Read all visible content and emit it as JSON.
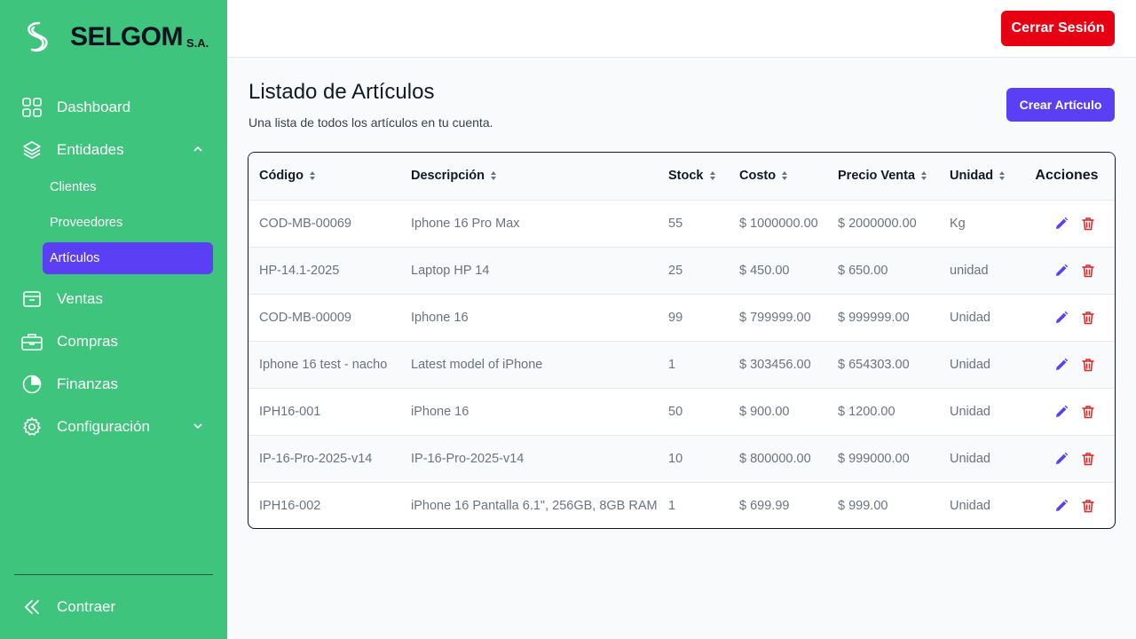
{
  "brand": {
    "name": "SELGOM",
    "suffix": "S.A."
  },
  "sidebar": {
    "items": [
      {
        "label": "Dashboard",
        "icon": "grid-icon"
      },
      {
        "label": "Entidades",
        "icon": "layers-icon",
        "expanded": true,
        "children": [
          {
            "label": "Clientes"
          },
          {
            "label": "Proveedores"
          },
          {
            "label": "Artículos",
            "active": true
          }
        ]
      },
      {
        "label": "Ventas",
        "icon": "archive-box-icon"
      },
      {
        "label": "Compras",
        "icon": "briefcase-icon"
      },
      {
        "label": "Finanzas",
        "icon": "pie-chart-icon"
      },
      {
        "label": "Configuración",
        "icon": "gear-icon",
        "expanded": false
      }
    ],
    "collapse_label": "Contraer"
  },
  "header": {
    "logout_label": "Cerrar Sesión"
  },
  "page": {
    "title": "Listado de Artículos",
    "subtitle": "Una lista de todos los artículos en tu cuenta.",
    "create_label": "Crear Artículo"
  },
  "table": {
    "columns": [
      "Código",
      "Descripción",
      "Stock",
      "Costo",
      "Precio Venta",
      "Unidad",
      "Acciones"
    ],
    "rows": [
      [
        "COD-MB-00069",
        "Iphone 16 Pro Max",
        "55",
        "$ 1000000.00",
        "$ 2000000.00",
        "Kg"
      ],
      [
        "HP-14.1-2025",
        "Laptop HP 14",
        "25",
        "$ 450.00",
        "$ 650.00",
        "unidad"
      ],
      [
        "COD-MB-00009",
        "Iphone 16",
        "99",
        "$ 799999.00",
        "$ 999999.00",
        "Unidad"
      ],
      [
        "Iphone 16 test - nacho",
        "Latest model of iPhone",
        "1",
        "$ 303456.00",
        "$ 654303.00",
        "Unidad"
      ],
      [
        "IPH16-001",
        "iPhone 16",
        "50",
        "$ 900.00",
        "$ 1200.00",
        "Unidad"
      ],
      [
        "IP-16-Pro-2025-v14",
        "IP-16-Pro-2025-v14",
        "10",
        "$ 800000.00",
        "$ 999000.00",
        "Unidad"
      ],
      [
        "IPH16-002",
        "iPhone 16 Pantalla 6.1\", 256GB, 8GB RAM",
        "1",
        "$ 699.99",
        "$ 999.00",
        "Unidad"
      ]
    ]
  },
  "colors": {
    "sidebar_bg": "#3ec47c",
    "accent": "#5b3ff5",
    "danger": "#e60012"
  }
}
